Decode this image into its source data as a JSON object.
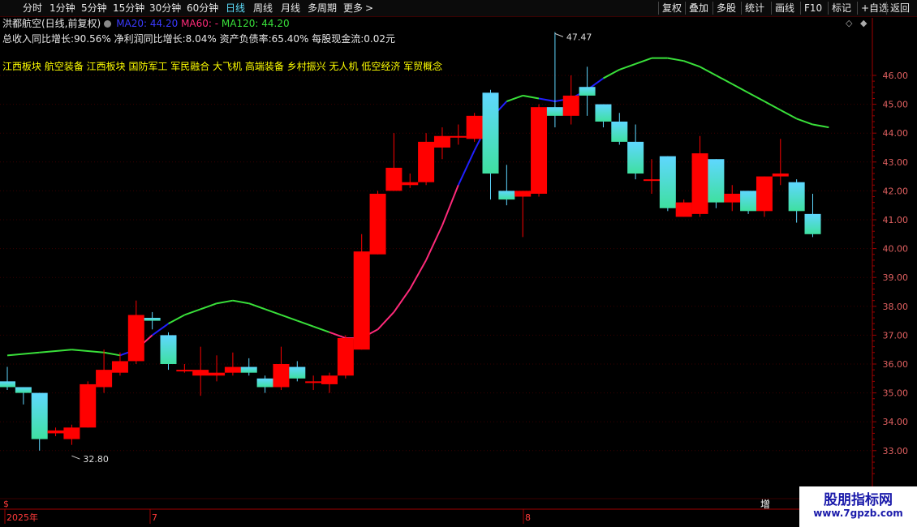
{
  "toolbar": {
    "left_items": [
      "分时",
      "1分钟",
      "5分钟",
      "15分钟",
      "30分钟",
      "60分钟",
      "日线",
      "周线",
      "月线",
      "多周期",
      "更多"
    ],
    "active": "日线",
    "more_arrow": ">",
    "right_items": [
      "复权",
      "叠加",
      "多股",
      "统计",
      "画线",
      "F10",
      "标记",
      "+自选",
      "返回"
    ]
  },
  "header": {
    "title": "洪都航空(日线,前复权)",
    "ma20": "MA20: 44.20",
    "ma60": "MA60: -",
    "ma120": "MA120: 44.20",
    "stats": "总收入同比增长:90.56%  净利润同比增长:8.04%  资产负债率:65.40%  每股现金流:0.02元",
    "concepts": "江西板块 航空装备 江西板块 国防军工 军民融合 大飞机 高端装备 乡村振兴 无人机 低空经济 军贸概念"
  },
  "colors": {
    "up": "#ff0000",
    "down_top": "#5fd7ff",
    "down_bottom": "#3fe0a0",
    "ma_up": "#ff2a7a",
    "ma_flat": "#39e03a",
    "ma_blue": "#2020ff",
    "axis": "#a00000",
    "grid": "#3a0000"
  },
  "chart_data": {
    "type": "candlestick",
    "yticks": [
      33.0,
      34.0,
      35.0,
      36.0,
      37.0,
      38.0,
      39.0,
      40.0,
      41.0,
      42.0,
      43.0,
      44.0,
      45.0,
      46.0
    ],
    "ylim": [
      32.0,
      47.9
    ],
    "max_annotation": "47.47",
    "min_annotation": "32.80",
    "date_labels": [
      "2025年",
      "7",
      "8"
    ],
    "candles": [
      {
        "o": 35.4,
        "c": 35.2,
        "h": 35.9,
        "l": 35.1
      },
      {
        "o": 35.2,
        "c": 35.0,
        "h": 35.2,
        "l": 34.6
      },
      {
        "o": 35.0,
        "c": 33.4,
        "h": 35.0,
        "l": 33.0
      },
      {
        "o": 33.6,
        "c": 33.7,
        "h": 33.8,
        "l": 33.5
      },
      {
        "o": 33.4,
        "c": 33.8,
        "h": 33.9,
        "l": 33.2
      },
      {
        "o": 33.8,
        "c": 35.3,
        "h": 35.4,
        "l": 33.8
      },
      {
        "o": 35.2,
        "c": 35.8,
        "h": 36.5,
        "l": 35.0
      },
      {
        "o": 35.7,
        "c": 36.1,
        "h": 36.4,
        "l": 35.6
      },
      {
        "o": 36.1,
        "c": 37.7,
        "h": 38.2,
        "l": 36.0
      },
      {
        "o": 37.6,
        "c": 37.5,
        "h": 37.8,
        "l": 37.2
      },
      {
        "o": 37.0,
        "c": 36.0,
        "h": 37.1,
        "l": 35.8
      },
      {
        "o": 35.8,
        "c": 35.8,
        "h": 36.0,
        "l": 35.7
      },
      {
        "o": 35.6,
        "c": 35.8,
        "h": 36.6,
        "l": 34.9
      },
      {
        "o": 35.6,
        "c": 35.7,
        "h": 36.3,
        "l": 35.4
      },
      {
        "o": 35.7,
        "c": 35.9,
        "h": 36.4,
        "l": 35.6
      },
      {
        "o": 35.9,
        "c": 35.7,
        "h": 36.2,
        "l": 35.6
      },
      {
        "o": 35.5,
        "c": 35.2,
        "h": 35.6,
        "l": 35.0
      },
      {
        "o": 35.2,
        "c": 36.0,
        "h": 36.6,
        "l": 35.1
      },
      {
        "o": 35.9,
        "c": 35.5,
        "h": 36.1,
        "l": 35.4
      },
      {
        "o": 35.4,
        "c": 35.4,
        "h": 35.6,
        "l": 35.1
      },
      {
        "o": 35.3,
        "c": 35.6,
        "h": 35.7,
        "l": 35.0
      },
      {
        "o": 35.6,
        "c": 36.9,
        "h": 37.0,
        "l": 35.5
      },
      {
        "o": 36.5,
        "c": 39.9,
        "h": 40.5,
        "l": 36.5
      },
      {
        "o": 39.8,
        "c": 41.9,
        "h": 42.0,
        "l": 39.8
      },
      {
        "o": 42.0,
        "c": 42.8,
        "h": 44.0,
        "l": 42.0
      },
      {
        "o": 42.2,
        "c": 42.3,
        "h": 42.6,
        "l": 42.1
      },
      {
        "o": 42.3,
        "c": 43.7,
        "h": 44.0,
        "l": 42.2
      },
      {
        "o": 43.5,
        "c": 43.9,
        "h": 44.2,
        "l": 43.1
      },
      {
        "o": 43.9,
        "c": 43.9,
        "h": 44.3,
        "l": 43.6
      },
      {
        "o": 43.8,
        "c": 44.6,
        "h": 44.7,
        "l": 43.7
      },
      {
        "o": 45.4,
        "c": 42.6,
        "h": 45.5,
        "l": 41.7
      },
      {
        "o": 42.0,
        "c": 41.7,
        "h": 42.9,
        "l": 41.5
      },
      {
        "o": 41.8,
        "c": 42.0,
        "h": 42.0,
        "l": 40.4
      },
      {
        "o": 41.9,
        "c": 44.9,
        "h": 45.0,
        "l": 41.8
      },
      {
        "o": 44.9,
        "c": 44.6,
        "h": 47.5,
        "l": 44.2
      },
      {
        "o": 44.6,
        "c": 45.3,
        "h": 46.0,
        "l": 44.3
      },
      {
        "o": 45.6,
        "c": 45.3,
        "h": 46.3,
        "l": 44.6
      },
      {
        "o": 45.0,
        "c": 44.4,
        "h": 45.0,
        "l": 44.2
      },
      {
        "o": 44.4,
        "c": 43.7,
        "h": 44.7,
        "l": 43.6
      },
      {
        "o": 43.7,
        "c": 42.6,
        "h": 44.3,
        "l": 42.4
      },
      {
        "o": 42.4,
        "c": 42.4,
        "h": 43.1,
        "l": 41.9
      },
      {
        "o": 43.2,
        "c": 41.4,
        "h": 43.2,
        "l": 41.3
      },
      {
        "o": 41.1,
        "c": 41.6,
        "h": 41.7,
        "l": 41.1
      },
      {
        "o": 41.2,
        "c": 43.3,
        "h": 43.9,
        "l": 41.1
      },
      {
        "o": 43.1,
        "c": 41.6,
        "h": 43.1,
        "l": 41.4
      },
      {
        "o": 41.6,
        "c": 41.9,
        "h": 42.2,
        "l": 41.3
      },
      {
        "o": 42.0,
        "c": 41.3,
        "h": 42.0,
        "l": 41.2
      },
      {
        "o": 41.3,
        "c": 42.5,
        "h": 42.5,
        "l": 41.1
      },
      {
        "o": 42.5,
        "c": 42.6,
        "h": 43.8,
        "l": 42.2
      },
      {
        "o": 42.3,
        "c": 41.3,
        "h": 42.4,
        "l": 40.9
      },
      {
        "o": 41.2,
        "c": 40.5,
        "h": 41.9,
        "l": 40.4
      }
    ],
    "ma_line": [
      {
        "i": 0,
        "v": 36.3
      },
      {
        "i": 2,
        "v": 36.4
      },
      {
        "i": 4,
        "v": 36.5
      },
      {
        "i": 6,
        "v": 36.4
      },
      {
        "i": 7,
        "v": 36.3
      },
      {
        "i": 8,
        "v": 36.5
      },
      {
        "i": 9,
        "v": 37.0
      },
      {
        "i": 10,
        "v": 37.4
      },
      {
        "i": 11,
        "v": 37.7
      },
      {
        "i": 12,
        "v": 37.9
      },
      {
        "i": 13,
        "v": 38.1
      },
      {
        "i": 14,
        "v": 38.2
      },
      {
        "i": 15,
        "v": 38.1
      },
      {
        "i": 16,
        "v": 37.9
      },
      {
        "i": 17,
        "v": 37.7
      },
      {
        "i": 18,
        "v": 37.5
      },
      {
        "i": 19,
        "v": 37.3
      },
      {
        "i": 20,
        "v": 37.1
      },
      {
        "i": 21,
        "v": 36.9
      },
      {
        "i": 22,
        "v": 36.9
      },
      {
        "i": 23,
        "v": 37.2
      },
      {
        "i": 24,
        "v": 37.8
      },
      {
        "i": 25,
        "v": 38.6
      },
      {
        "i": 26,
        "v": 39.6
      },
      {
        "i": 27,
        "v": 40.8
      },
      {
        "i": 28,
        "v": 42.2
      },
      {
        "i": 29,
        "v": 43.4
      },
      {
        "i": 30,
        "v": 44.5
      },
      {
        "i": 31,
        "v": 45.1
      },
      {
        "i": 32,
        "v": 45.3
      },
      {
        "i": 33,
        "v": 45.2
      },
      {
        "i": 34,
        "v": 45.1
      },
      {
        "i": 35,
        "v": 45.2
      },
      {
        "i": 36,
        "v": 45.5
      },
      {
        "i": 37,
        "v": 45.9
      },
      {
        "i": 38,
        "v": 46.2
      },
      {
        "i": 39,
        "v": 46.4
      },
      {
        "i": 40,
        "v": 46.6
      },
      {
        "i": 41,
        "v": 46.6
      },
      {
        "i": 42,
        "v": 46.5
      },
      {
        "i": 43,
        "v": 46.3
      },
      {
        "i": 44,
        "v": 46.0
      },
      {
        "i": 45,
        "v": 45.7
      },
      {
        "i": 46,
        "v": 45.4
      },
      {
        "i": 47,
        "v": 45.1
      },
      {
        "i": 48,
        "v": 44.8
      },
      {
        "i": 49,
        "v": 44.5
      },
      {
        "i": 50,
        "v": 44.3
      },
      {
        "i": 51,
        "v": 44.2
      }
    ]
  },
  "bottom": {
    "left_marker": "$",
    "right_marker": "增"
  },
  "watermark": {
    "line1": "股朋指标网",
    "line2": "www.7gpzb.com"
  }
}
